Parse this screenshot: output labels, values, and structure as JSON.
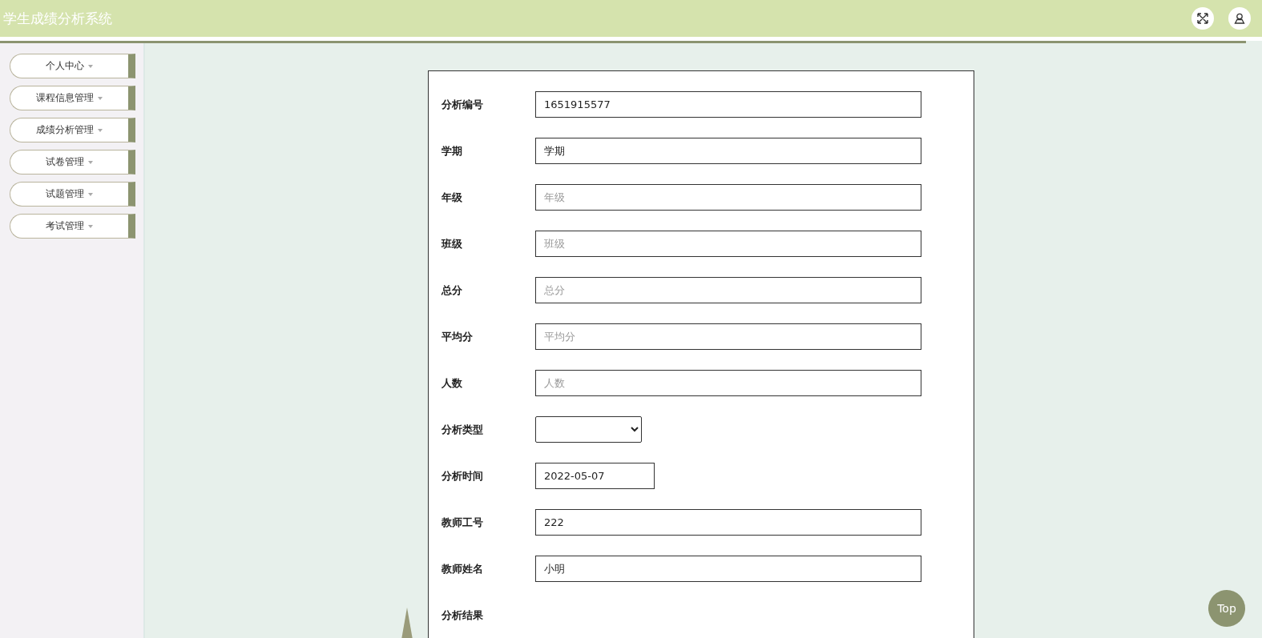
{
  "header": {
    "title": "学生成绩分析系统"
  },
  "sidebar": {
    "items": [
      {
        "label": "个人中心"
      },
      {
        "label": "课程信息管理"
      },
      {
        "label": "成绩分析管理"
      },
      {
        "label": "试卷管理"
      },
      {
        "label": "试题管理"
      },
      {
        "label": "考试管理"
      }
    ]
  },
  "form": {
    "fields": [
      {
        "label": "分析编号",
        "kind": "text",
        "value": "1651915577"
      },
      {
        "label": "学期",
        "kind": "text",
        "value": "学期"
      },
      {
        "label": "年级",
        "kind": "text",
        "placeholder": "年级"
      },
      {
        "label": "班级",
        "kind": "text",
        "placeholder": "班级"
      },
      {
        "label": "总分",
        "kind": "text",
        "placeholder": "总分"
      },
      {
        "label": "平均分",
        "kind": "text",
        "placeholder": "平均分"
      },
      {
        "label": "人数",
        "kind": "text",
        "placeholder": "人数"
      },
      {
        "label": "分析类型",
        "kind": "select"
      },
      {
        "label": "分析时间",
        "kind": "date",
        "value": "2022-05-07"
      },
      {
        "label": "教师工号",
        "kind": "text",
        "value": "222"
      },
      {
        "label": "教师姓名",
        "kind": "text",
        "value": "小明"
      },
      {
        "label": "分析结果",
        "kind": "none"
      }
    ]
  },
  "top_button": {
    "label": "Top"
  }
}
